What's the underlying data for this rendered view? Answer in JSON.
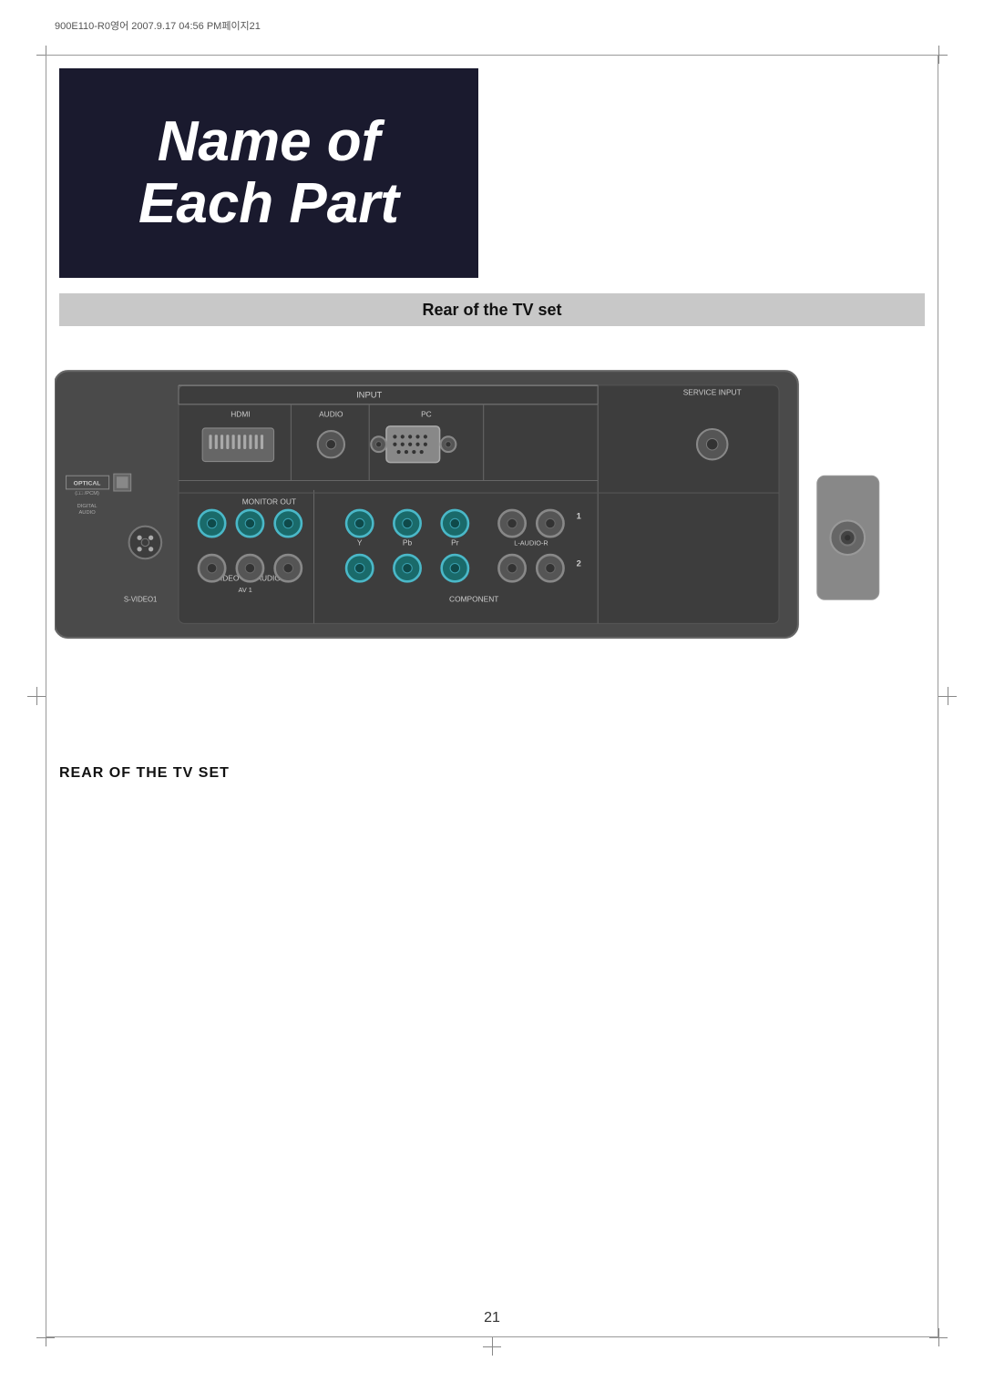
{
  "meta": {
    "header": "900E110-R0영어  2007.9.17  04:56 PM페이지21"
  },
  "title": {
    "line1": "Name of",
    "line2": "Each Part"
  },
  "section": {
    "header": "Rear of the TV set"
  },
  "diagram": {
    "labels": {
      "input": "INPUT",
      "service_input": "SERVICE INPUT",
      "hdmi": "HDMI",
      "audio": "AUDIO",
      "pc": "PC",
      "optical": "OPTICAL",
      "optical_sub": "(□□ /PCM)",
      "digital_audio": "DIGITAL\nAUDIO",
      "monitor_out": "MONITOR OUT",
      "svideo1": "S-VIDEO1",
      "video": "VIDEO",
      "l_audio_r_av1": "L-AUDIO-R",
      "av1": "AV 1",
      "y": "Y",
      "pb": "Pb",
      "pr": "Pr",
      "l_audio_r_comp": "L-AUDIO-R",
      "component": "COMPONENT",
      "num1": "1",
      "num2": "2"
    },
    "rear_label": "REAR OF THE TV SET"
  },
  "page": {
    "number": "21"
  }
}
